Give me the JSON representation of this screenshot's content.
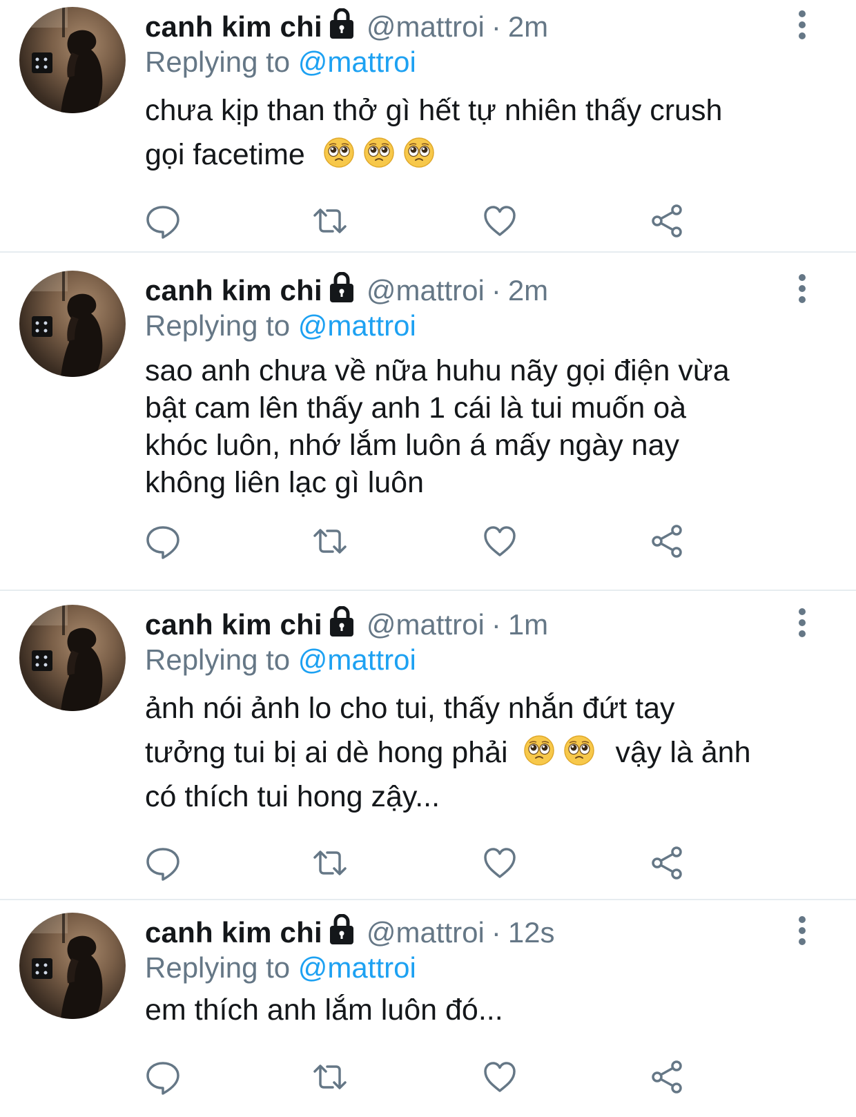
{
  "colors": {
    "text": "#14171a",
    "secondary": "#657786",
    "accent": "#1da1f2",
    "divider": "#e6ecf0",
    "icon": "#657786"
  },
  "tweets": [
    {
      "name": "canh kim chi",
      "handle": "@mattroi",
      "separator": "·",
      "time": "2m",
      "replying_prefix": "Replying to",
      "replying_to": "@mattroi",
      "lines": [
        "chưa kịp than thở gì hết tự nhiên thấy crush",
        "gọi facetime"
      ],
      "emoji": "pleading-face-emoji",
      "icons": [
        "lock-icon",
        "more-options-icon",
        "reply-icon",
        "retweet-icon",
        "like-icon",
        "share-icon"
      ]
    },
    {
      "name": "canh kim chi",
      "handle": "@mattroi",
      "separator": "·",
      "time": "2m",
      "replying_prefix": "Replying to",
      "replying_to": "@mattroi",
      "lines": [
        "sao anh chưa về nữa huhu nãy gọi điện vừa",
        "bật cam lên thấy anh 1 cái là tui muốn oà",
        "khóc luôn, nhớ lắm luôn á mấy ngày nay",
        "không liên lạc gì luôn"
      ]
    },
    {
      "name": "canh kim chi",
      "handle": "@mattroi",
      "separator": "·",
      "time": "1m",
      "replying_prefix": "Replying to",
      "replying_to": "@mattroi",
      "lines": [
        "ảnh nói ảnh lo cho tui, thấy nhắn đứt tay",
        "tưởng tui bị ai dè hong phải",
        "vậy là ảnh",
        "có thích tui hong zậy..."
      ]
    },
    {
      "name": "canh kim chi",
      "handle": "@mattroi",
      "separator": "·",
      "time": "12s",
      "replying_prefix": "Replying to",
      "replying_to": "@mattroi",
      "lines": [
        "em thích anh lắm luôn đó..."
      ]
    }
  ]
}
